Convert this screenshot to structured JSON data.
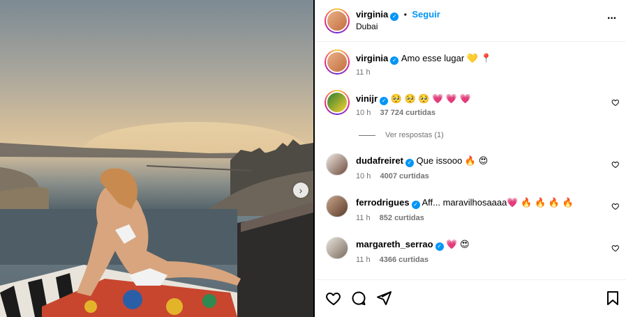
{
  "post": {
    "author": "virginia",
    "follow_label": "Seguir",
    "separator": "•",
    "location": "Dubai",
    "more_label": "···"
  },
  "caption": {
    "username": "virginia",
    "text": "Amo esse lugar 💛 📍",
    "time": "11 h"
  },
  "comments": [
    {
      "username": "vinijr",
      "text": "🥺 🥺 🥺 💗 💗 💗",
      "time": "10 h",
      "likes": "37 724 curtidas"
    },
    {
      "username": "dudafreiret",
      "text": "Que issooo 🔥 😍",
      "time": "10 h",
      "likes": "4007 curtidas"
    },
    {
      "username": "ferrodrigues",
      "text": "Aff... maravilhosaaaa💗 🔥 🔥 🔥 🔥",
      "time": "11 h",
      "likes": "852 curtidas"
    },
    {
      "username": "margareth_serrao",
      "text": "💗 😍",
      "time": "11 h",
      "likes": "4366 curtidas"
    }
  ],
  "replies": {
    "label": "Ver respostas (1)"
  },
  "photo": {
    "next_arrow": "›"
  },
  "colors": {
    "verified": "#0095f6",
    "follow": "#0095f6",
    "meta": "#737373"
  },
  "icons": [
    "more-icon",
    "heart-icon",
    "comment-icon",
    "share-icon",
    "bookmark-icon",
    "chevron-right-icon",
    "verified-icon"
  ]
}
